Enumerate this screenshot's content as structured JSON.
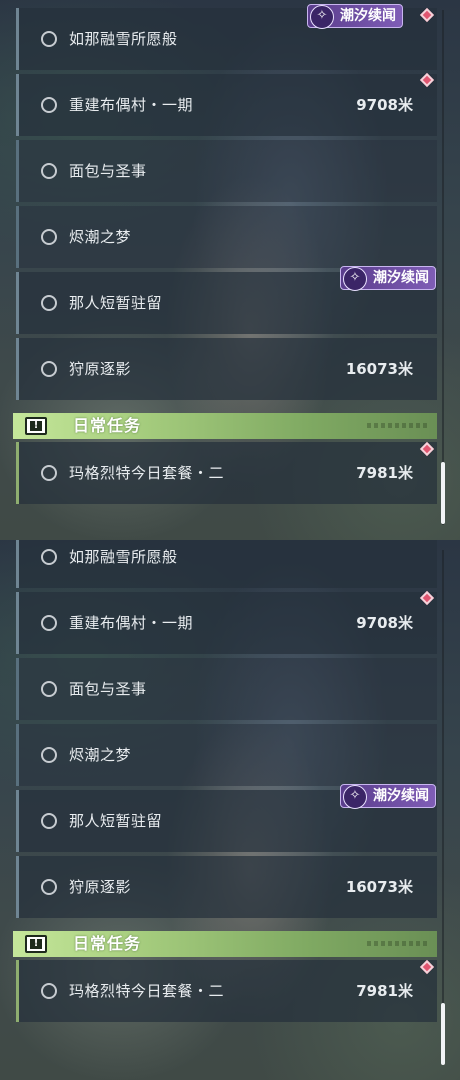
{
  "event_badge": {
    "label": "潮汐续闻",
    "icon": "tide-emblem-icon"
  },
  "daily_section": {
    "title": "日常任务",
    "icon": "alert-icon"
  },
  "panels": [
    {
      "quests": [
        {
          "label": "如那融雪所愿般",
          "distance": ""
        },
        {
          "label": "重建布偶村・一期",
          "distance": "9708米"
        },
        {
          "label": "面包与圣事",
          "distance": ""
        },
        {
          "label": "烬潮之梦",
          "distance": ""
        },
        {
          "label": "那人短暂驻留",
          "distance": ""
        },
        {
          "label": "狩原逐影",
          "distance": "16073米"
        }
      ],
      "daily_quests": [
        {
          "label": "玛格烈特今日套餐・二",
          "distance": "7981米"
        }
      ]
    },
    {
      "quests": [
        {
          "label": "如那融雪所愿般",
          "distance": ""
        },
        {
          "label": "重建布偶村・一期",
          "distance": "9708米"
        },
        {
          "label": "面包与圣事",
          "distance": ""
        },
        {
          "label": "烬潮之梦",
          "distance": ""
        },
        {
          "label": "那人短暂驻留",
          "distance": ""
        },
        {
          "label": "狩原逐影",
          "distance": "16073米"
        }
      ],
      "daily_quests": [
        {
          "label": "玛格烈特今日套餐・二",
          "distance": "7981米"
        }
      ]
    }
  ],
  "colors": {
    "accent_green": "#a6cd7e",
    "event_purple": "#6a4aa0",
    "marker_red": "#e05570"
  }
}
